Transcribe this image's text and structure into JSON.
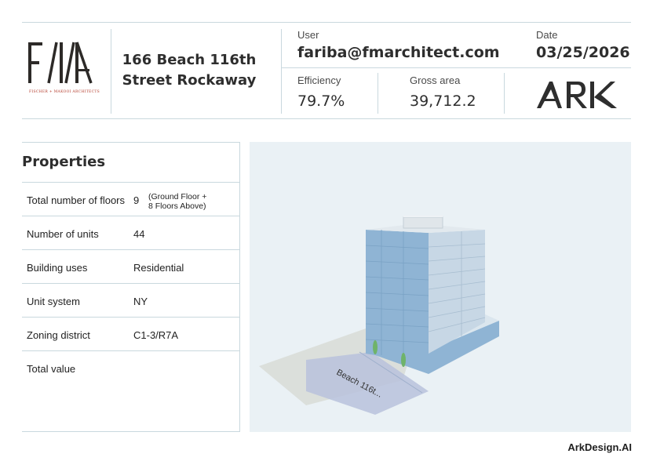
{
  "header": {
    "firm_logo_text": "F/\\/\\",
    "firm_name": "FISCHER + MAKOOI ARCHITECTS",
    "project_title_line1": "166 Beach 116th",
    "project_title_line2": "Street Rockaway",
    "user_label": "User",
    "user_value": "fariba@fmarchitect.com",
    "date_label": "Date",
    "date_value": "03/25/2026",
    "efficiency_label": "Efficiency",
    "efficiency_value": "79.7%",
    "gross_area_label": "Gross area",
    "gross_area_value": "39,712.2",
    "brand_logo_text": "ARK"
  },
  "properties": {
    "heading": "Properties",
    "rows": [
      {
        "label": "Total number of floors",
        "value": "9",
        "note_line1": "(Ground Floor +",
        "note_line2": "8 Floors Above)"
      },
      {
        "label": "Number of units",
        "value": "44"
      },
      {
        "label": "Building uses",
        "value": "Residential"
      },
      {
        "label": "Unit system",
        "value": "NY"
      },
      {
        "label": "Zoning district",
        "value": "C1-3/R7A"
      },
      {
        "label": "Total value",
        "value": ""
      }
    ]
  },
  "model_view": {
    "street_label": "Beach 116t..."
  },
  "footer": {
    "brand": "ArkDesign.AI"
  },
  "colors": {
    "rule_line": "#c9d8de",
    "model_background": "#eaf1f5",
    "facade_blue": "#8fb4d4",
    "firm_name_red": "#b33a2a"
  }
}
